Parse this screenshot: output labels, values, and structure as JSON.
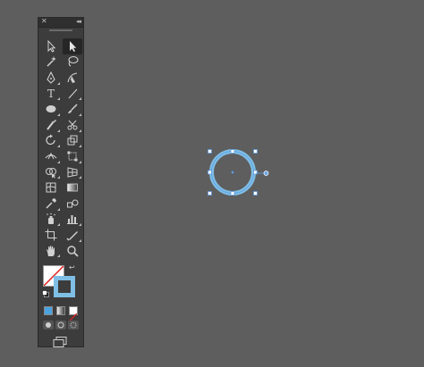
{
  "toolbar": {
    "close_glyph": "✕",
    "collapse_glyph": "◂◂",
    "tools": [
      {
        "name": "selection-tool",
        "icon": "arrow-black-icon",
        "active": false
      },
      {
        "name": "direct-selection-tool",
        "icon": "arrow-white-icon",
        "active": true
      },
      {
        "name": "magic-wand-tool",
        "icon": "magic-wand-icon",
        "active": false
      },
      {
        "name": "lasso-tool",
        "icon": "lasso-icon",
        "active": false
      },
      {
        "name": "pen-tool",
        "icon": "pen-icon",
        "active": false
      },
      {
        "name": "curvature-tool",
        "icon": "curvature-pen-icon",
        "active": false
      },
      {
        "name": "type-tool",
        "icon": "type-icon",
        "active": false,
        "glyph": "T"
      },
      {
        "name": "line-segment-tool",
        "icon": "line-icon",
        "active": false
      },
      {
        "name": "ellipse-tool",
        "icon": "ellipse-icon",
        "active": false
      },
      {
        "name": "paintbrush-tool",
        "icon": "brush-icon",
        "active": false
      },
      {
        "name": "shaper-tool",
        "icon": "shaper-icon",
        "active": false
      },
      {
        "name": "scissors-tool",
        "icon": "scissors-icon",
        "active": false
      },
      {
        "name": "rotate-tool",
        "icon": "rotate-icon",
        "active": false
      },
      {
        "name": "scale-tool",
        "icon": "scale-icon",
        "active": false
      },
      {
        "name": "width-tool",
        "icon": "width-icon",
        "active": false
      },
      {
        "name": "free-transform-tool",
        "icon": "free-transform-icon",
        "active": false
      },
      {
        "name": "shape-builder-tool",
        "icon": "shape-builder-icon",
        "active": false
      },
      {
        "name": "perspective-grid-tool",
        "icon": "perspective-grid-icon",
        "active": false
      },
      {
        "name": "mesh-tool",
        "icon": "mesh-icon",
        "active": false
      },
      {
        "name": "gradient-tool",
        "icon": "gradient-icon",
        "active": false
      },
      {
        "name": "eyedropper-tool",
        "icon": "eyedropper-icon",
        "active": false
      },
      {
        "name": "blend-tool",
        "icon": "blend-icon",
        "active": false
      },
      {
        "name": "symbol-sprayer-tool",
        "icon": "symbol-sprayer-icon",
        "active": false
      },
      {
        "name": "column-graph-tool",
        "icon": "column-graph-icon",
        "active": false
      },
      {
        "name": "artboard-tool",
        "icon": "artboard-icon",
        "active": false
      },
      {
        "name": "slice-tool",
        "icon": "slice-icon",
        "active": false
      },
      {
        "name": "hand-tool",
        "icon": "hand-icon",
        "active": false
      },
      {
        "name": "zoom-tool",
        "icon": "zoom-icon",
        "active": false
      }
    ],
    "colors": {
      "fill": "#ffffff",
      "fill_none_slash": "#e02020",
      "stroke": "#7fbfe6"
    },
    "color_modes": [
      {
        "name": "color-mode-button",
        "color": "#4aa3df"
      },
      {
        "name": "gradient-mode-button",
        "color": "#9a9a9a"
      },
      {
        "name": "none-mode-button",
        "color": "#ffffff"
      }
    ]
  },
  "canvas": {
    "background": "#5e5e5e",
    "selection_color": "#6aa7ea",
    "object_stroke": "#7fbfe6"
  }
}
